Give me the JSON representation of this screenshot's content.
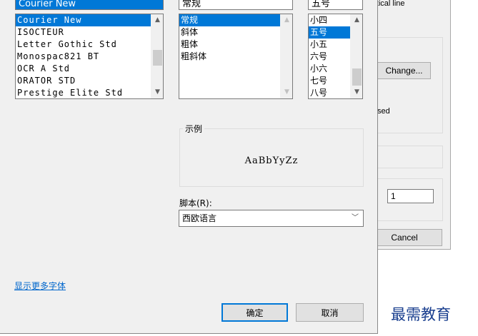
{
  "background_dialog": {
    "vertical_line_text": "ertical line",
    "change_button": "Change...",
    "used_text": "sed",
    "number_value": "1",
    "cancel_button": "Cancel"
  },
  "font_dialog": {
    "font": {
      "current_value": "Courier New",
      "items": [
        "Courier New",
        "ISOCTEUR",
        "Letter Gothic Std",
        "Monospac821 BT",
        "OCR A Std",
        "ORATOR STD",
        "Prestige Elite Std"
      ],
      "selected_index": 0
    },
    "style": {
      "current_value": "常规",
      "items": [
        "常规",
        "斜体",
        "粗体",
        "粗斜体"
      ],
      "selected_index": 0
    },
    "size": {
      "current_value": "五号",
      "items": [
        "小四",
        "五号",
        "小五",
        "六号",
        "小六",
        "七号",
        "八号"
      ],
      "selected_index": 1
    },
    "sample": {
      "label": "示例",
      "text": "AaBbYyZz"
    },
    "script": {
      "label": "脚本(R):",
      "value": "西欧语言"
    },
    "more_fonts_link": "显示更多字体",
    "ok_button": "确定",
    "cancel_button": "取消"
  },
  "watermark": "最需教育",
  "icons": {
    "scroll_up": "▲",
    "scroll_down": "▼",
    "dropdown": "﹀"
  },
  "colors": {
    "selection": "#0078d7",
    "link": "#0066cc",
    "dialog_bg": "#f0f0f0"
  }
}
